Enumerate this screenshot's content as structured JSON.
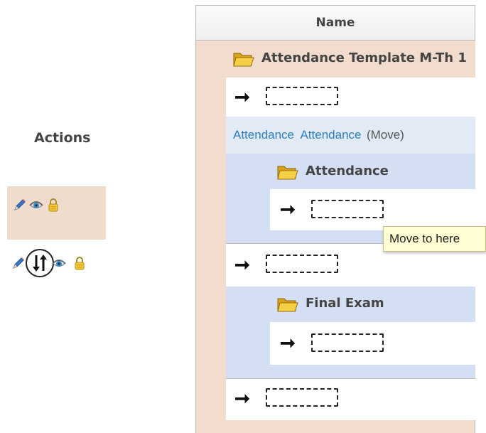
{
  "actions": {
    "header": "Actions",
    "rows": [
      {
        "icons": [
          "pencil-icon",
          "eye-icon",
          "lock-icon"
        ]
      },
      {
        "icons": [
          "pencil-icon",
          "move-arrows-icon",
          "eye-icon",
          "lock-icon"
        ]
      }
    ]
  },
  "table": {
    "header": "Name",
    "category_title": "Attendance Template M-Th 1",
    "course_links": {
      "link1": "Attendance",
      "link2": "Attendance",
      "move_text": "(Move)"
    },
    "items": [
      {
        "title": "Attendance"
      },
      {
        "title": "Final Exam"
      }
    ]
  },
  "tooltip": "Move to here",
  "colors": {
    "category_bg": "#f1dccd",
    "item_bg": "#d4dff4",
    "link": "#2a7fbf",
    "tooltip_bg": "#fffdd3"
  }
}
